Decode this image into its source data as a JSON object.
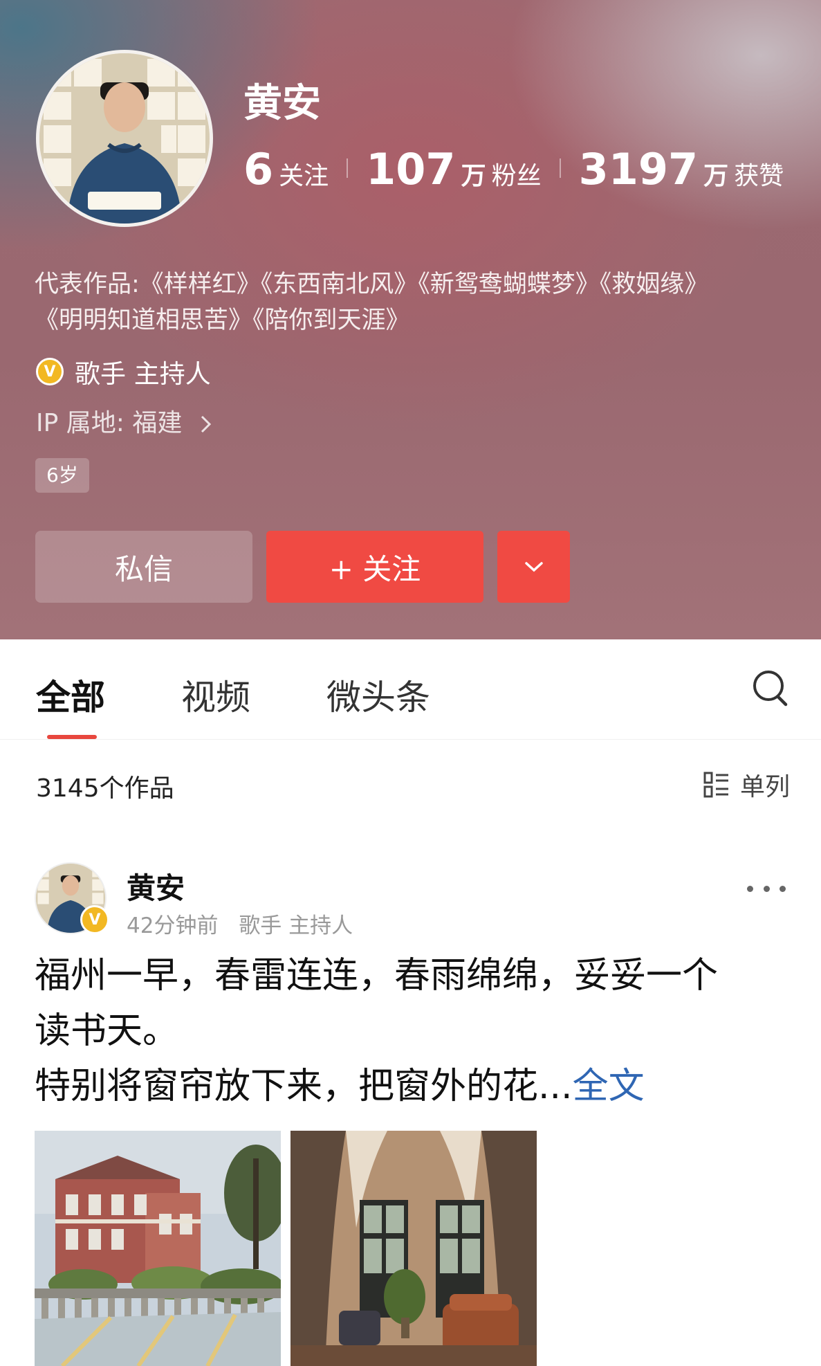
{
  "profile": {
    "name": "黄安",
    "stats": {
      "following_num": "6",
      "following_label": "关注",
      "fans_num": "107",
      "fans_unit": "万",
      "fans_label": "粉丝",
      "likes_num": "3197",
      "likes_unit": "万",
      "likes_label": "获赞"
    },
    "works_line1": "代表作品:《样样红》《东西南北风》《新鸳鸯蝴蝶梦》《救姻缘》",
    "works_line2": "《明明知道相思苦》《陪你到天涯》",
    "verified_badge": "V",
    "verified_title": "歌手 主持人",
    "ip_location": "IP 属地: 福建",
    "account_age": "6岁"
  },
  "actions": {
    "message_label": "私信",
    "follow_label": "+ 关注"
  },
  "tabs": [
    {
      "label": "全部",
      "active": true
    },
    {
      "label": "视频",
      "active": false
    },
    {
      "label": "微头条",
      "active": false
    }
  ],
  "feed": {
    "count_text": "3145个作品",
    "layout_label": "单列"
  },
  "post": {
    "author": "黄安",
    "time": "42分钟前",
    "author_title": "歌手 主持人",
    "badge": "V",
    "text_line1": "福州一早，春雷连连，春雨绵绵，妥妥一个",
    "text_line2": "读书天。",
    "text_line3": "特别将窗帘放下来，把窗外的花...",
    "more_label": "全文"
  },
  "colors": {
    "accent_red": "#f04a43",
    "tab_underline": "#e8473e",
    "link_blue": "#2f66b3",
    "verified_gold": "#f2b823"
  },
  "icons": [
    "search-icon",
    "chevron-down-icon",
    "chevron-right-icon",
    "list-layout-icon",
    "more-dots-icon",
    "verified-badge-icon"
  ]
}
